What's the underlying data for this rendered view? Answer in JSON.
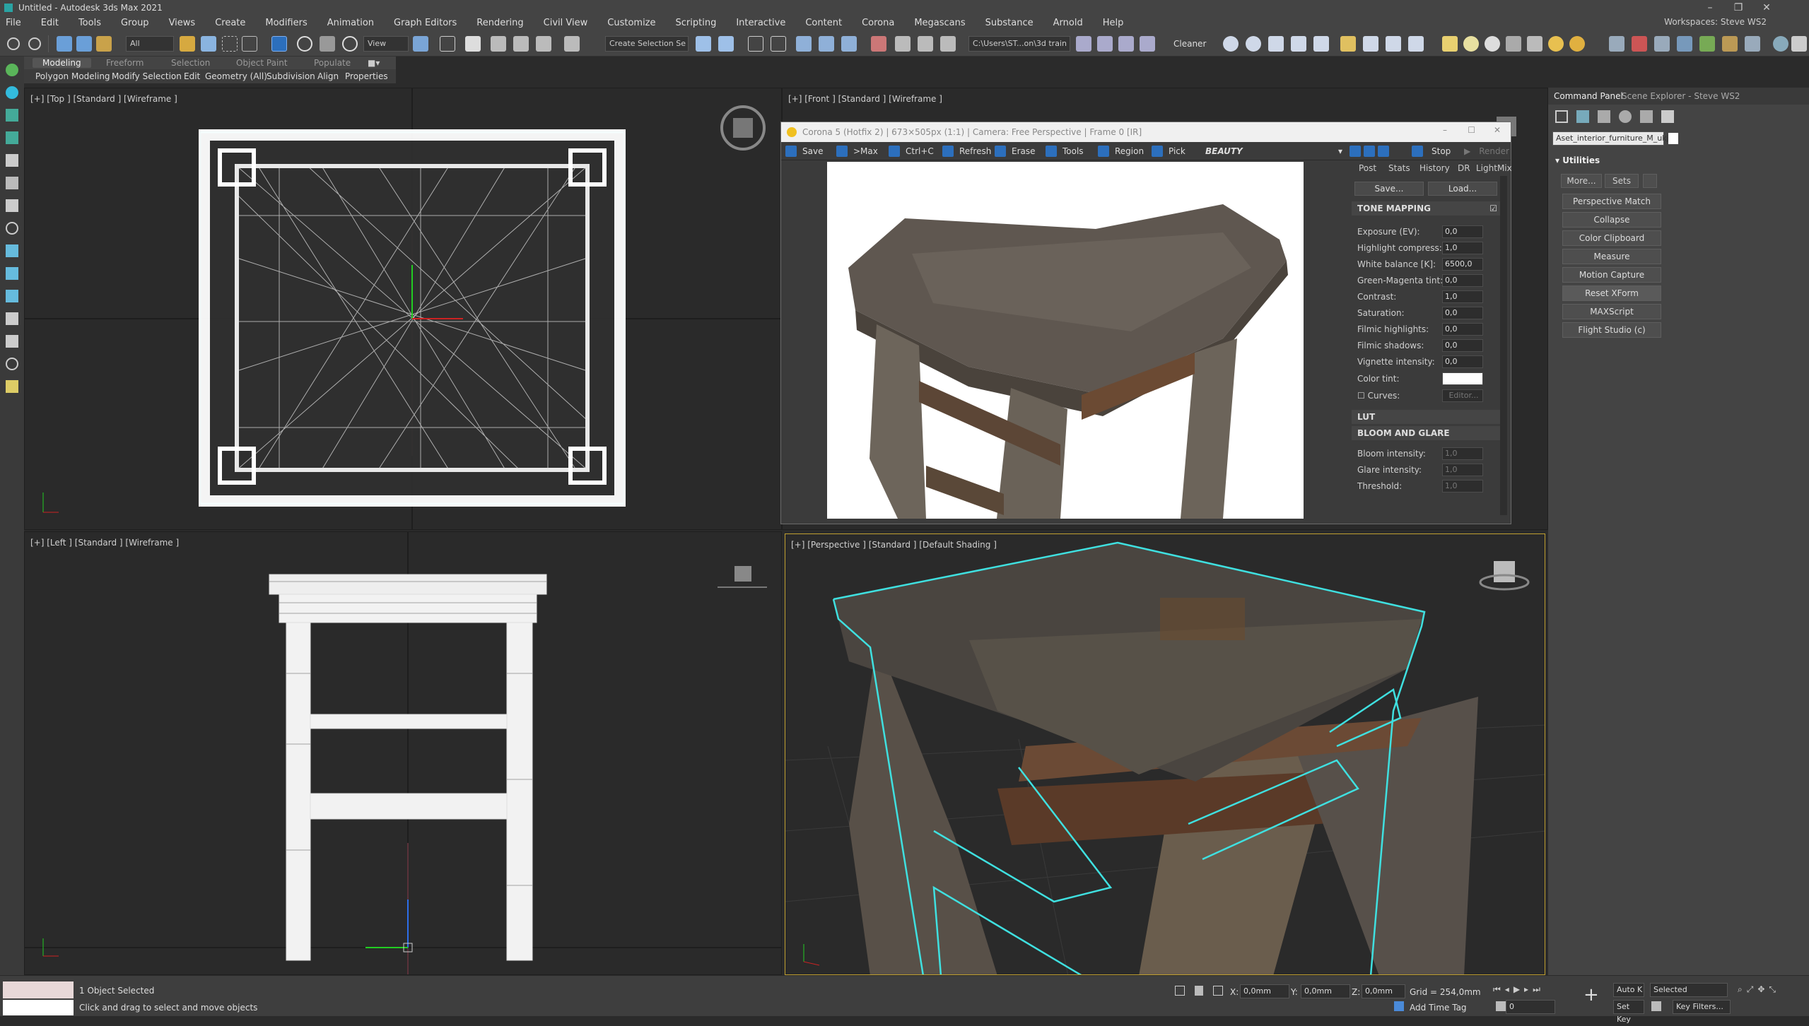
{
  "app": {
    "title": "Untitled - Autodesk 3ds Max 2021"
  },
  "menu": [
    "File",
    "Edit",
    "Tools",
    "Group",
    "Views",
    "Create",
    "Modifiers",
    "Animation",
    "Graph Editors",
    "Rendering",
    "Civil View",
    "Customize",
    "Scripting",
    "Interactive",
    "Content",
    "Corona",
    "Megascans",
    "Substance",
    "Arnold",
    "Help"
  ],
  "workspaces": "Workspaces:  Steve WS2",
  "toolbar": {
    "filter": "All",
    "view": "View",
    "selection_set": "Create Selection Se",
    "path": "C:\\Users\\ST...on\\3d train",
    "cleaner": "Cleaner"
  },
  "ribbon": {
    "tabs": [
      "Modeling",
      "Freeform",
      "Selection",
      "Object Paint",
      "Populate"
    ],
    "subtabs": [
      "Polygon Modeling",
      "Modify Selection",
      "Edit",
      "Geometry (All)",
      "Subdivision",
      "Align",
      "Properties"
    ]
  },
  "viewports": {
    "top": "[+] [Top ] [Standard ] [Wireframe ]",
    "front": "[+] [Front ] [Standard ] [Wireframe ]",
    "left": "[+] [Left ] [Standard ] [Wireframe ]",
    "persp": "[+] [Perspective ] [Standard ] [Default Shading ]"
  },
  "render_window": {
    "title": "Corona 5 (Hotfix 2) | 673×505px (1:1) | Camera: Free Perspective | Frame 0 [IR]",
    "buttons": [
      "Save",
      ">Max",
      "Ctrl+C",
      "Refresh",
      "Erase",
      "Tools",
      "Region",
      "Pick"
    ],
    "beauty": "BEAUTY",
    "stop": "Stop",
    "render": "Render",
    "tabs": [
      "Post",
      "Stats",
      "History",
      "DR",
      "LightMix"
    ],
    "save_btn": "Save...",
    "load_btn": "Load...",
    "tone_mapping": "TONE MAPPING",
    "params": [
      {
        "label": "Exposure (EV):",
        "value": "0,0"
      },
      {
        "label": "Highlight compress:",
        "value": "1,0"
      },
      {
        "label": "White balance [K]:",
        "value": "6500,0"
      },
      {
        "label": "Green-Magenta tint:",
        "value": "0,0"
      },
      {
        "label": "Contrast:",
        "value": "1,0"
      },
      {
        "label": "Saturation:",
        "value": "0,0"
      },
      {
        "label": "Filmic highlights:",
        "value": "0,0"
      },
      {
        "label": "Filmic shadows:",
        "value": "0,0"
      },
      {
        "label": "Vignette intensity:",
        "value": "0,0"
      }
    ],
    "color_tint": "Color tint:",
    "curves": "Curves:",
    "curves_btn": "Editor...",
    "lut": "LUT",
    "bloom": "BLOOM AND GLARE",
    "bloom_params": [
      {
        "label": "Bloom intensity:",
        "value": "1,0"
      },
      {
        "label": "Glare intensity:",
        "value": "1,0"
      },
      {
        "label": "Threshold:",
        "value": "1,0"
      }
    ]
  },
  "command_panel": {
    "tabs": [
      "Command Panel",
      "Scene Explorer - Steve WS2"
    ],
    "object_name": "Aset_interior_furniture_M_ukjn",
    "rollout": "Utilities",
    "more": "More...",
    "sets": "Sets",
    "buttons": [
      "Perspective Match",
      "Collapse",
      "Color Clipboard",
      "Measure",
      "Motion Capture",
      "Reset XForm",
      "MAXScript",
      "Flight Studio (c)"
    ]
  },
  "status": {
    "selected": "1 Object Selected",
    "prompt": "Click and drag to select and move objects",
    "x_label": "X:",
    "x": "0,0mm",
    "y_label": "Y:",
    "y": "0,0mm",
    "z_label": "Z:",
    "z": "0,0mm",
    "grid": "Grid = 254,0mm",
    "add_time_tag": "Add Time Tag",
    "auto_key": "Auto K",
    "selected_dd": "Selected",
    "set_key": "Set Key",
    "key_filters": "Key Filters...",
    "frame": "0"
  },
  "colors": {
    "selection": "#3fe0e0",
    "accent": "#2c6fbd"
  }
}
